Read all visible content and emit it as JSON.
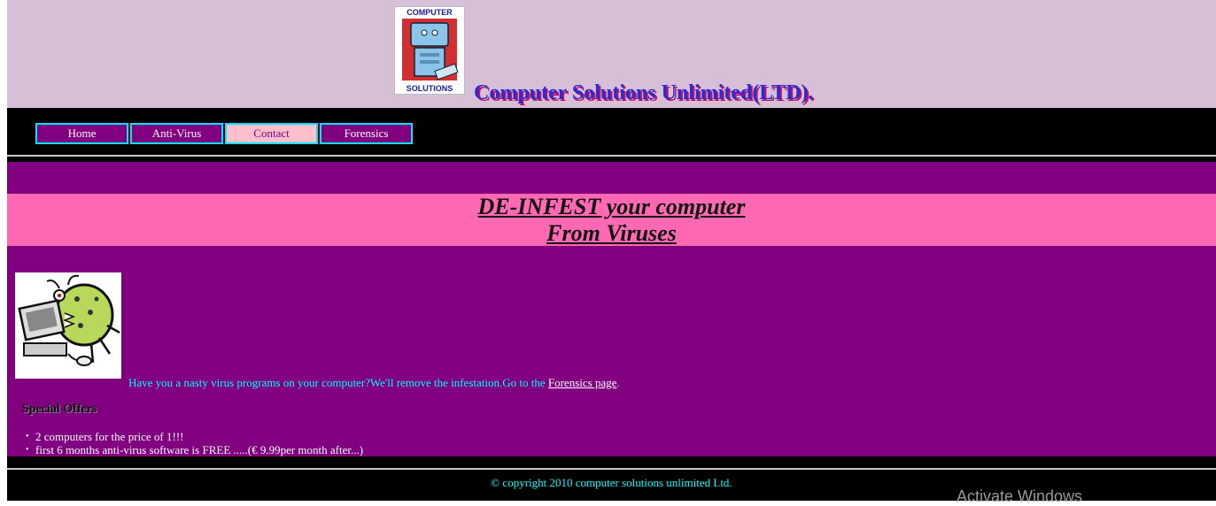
{
  "header": {
    "logo_text_top": "COMPUTER",
    "logo_text_bottom": "SOLUTIONS",
    "title": "Computer Solutions Unlimited(LTD)."
  },
  "nav": {
    "items": [
      {
        "label": "Home",
        "active": false
      },
      {
        "label": "Anti-Virus",
        "active": false
      },
      {
        "label": "Contact",
        "active": true
      },
      {
        "label": "Forensics",
        "active": false
      }
    ]
  },
  "banner": {
    "line1": "DE-INFEST your computer",
    "line2": "From Viruses"
  },
  "intro": {
    "text": "Have you a nasty virus programs on your computer?We'll remove the infestation.Go to the ",
    "link": "Forensics page",
    "suffix": "."
  },
  "offers": {
    "title": "Special Offers",
    "items": [
      "2 computers for the price of 1!!!",
      "first 6 months anti-virus software is FREE .....(€ 9.99per month after...)"
    ]
  },
  "footer": {
    "text": "© copyright 2010 computer solutions unlimited Ltd."
  },
  "overlay": {
    "watermark": "Activate Windows"
  },
  "colors": {
    "header_bg": "#d8bfd8",
    "nav_item_bg": "#800080",
    "nav_active_bg": "#ffc0cb",
    "nav_border": "#00e5ff",
    "main_bg": "#800080",
    "banner_bg": "#ff69b4",
    "intro_text": "#00ffff",
    "title_text": "#2b2bd0"
  }
}
